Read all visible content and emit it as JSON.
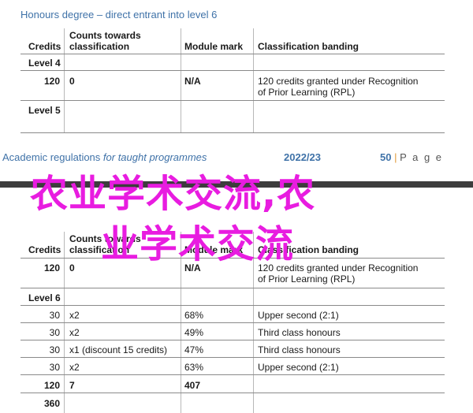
{
  "top": {
    "heading": "Honours degree – direct entrant into level 6",
    "headers": {
      "credits": "Credits",
      "counts_l1": "Counts towards",
      "counts_l2": "classification",
      "module": "Module mark",
      "banding": "Classification banding"
    },
    "level4": "Level 4",
    "row": {
      "credits": "120",
      "counts": "0",
      "module": "N/A",
      "banding_l1": "120 credits granted under Recognition",
      "banding_l2": "of Prior Learning (RPL)"
    },
    "level5": "Level 5"
  },
  "footer": {
    "left_bold": "Academic regulations",
    "left_rest": " for taught programmes",
    "year": "2022/23",
    "page_num": "50",
    "sep": " | ",
    "page_word": "P a g e"
  },
  "watermark": {
    "line1": "农业学术交流,农",
    "line2": "业学术交流"
  },
  "bottom": {
    "headers": {
      "credits": "Credits",
      "counts_l1": "Counts towards",
      "counts_l2": "classification",
      "module": "Module mark",
      "banding": "Classification banding"
    },
    "row_rpl": {
      "credits": "120",
      "counts": "0",
      "module": "N/A",
      "banding_l1": "120 credits granted under Recognition",
      "banding_l2": "of Prior Learning (RPL)"
    },
    "level6": "Level 6",
    "rows": [
      {
        "credits": "30",
        "counts": "x2",
        "module": "68%",
        "banding": "Upper second (2:1)"
      },
      {
        "credits": "30",
        "counts": "x2",
        "module": "49%",
        "banding": "Third class honours"
      },
      {
        "credits": "30",
        "counts": "x1 (discount 15 credits)",
        "module": "47%",
        "banding": "Third class honours"
      },
      {
        "credits": "30",
        "counts": "x2",
        "module": "63%",
        "banding": "Upper second (2:1)"
      }
    ],
    "total": {
      "credits": "120",
      "counts": "7",
      "module": "407"
    },
    "grand_total": {
      "credits": "360"
    }
  }
}
